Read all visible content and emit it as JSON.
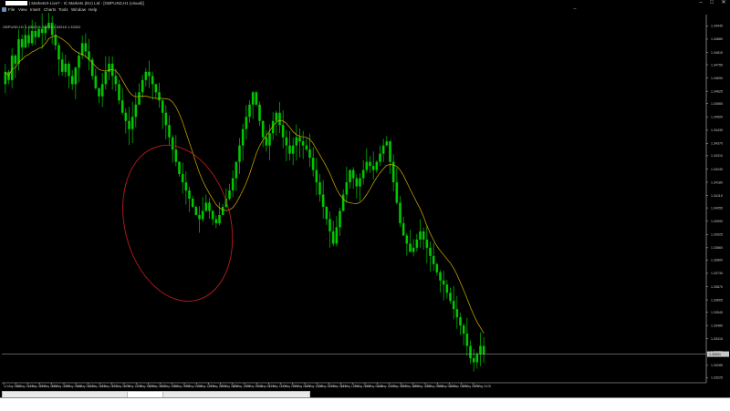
{
  "window": {
    "title": "| MarketsX-Live7 - IC Markets (EU) Ltd - [GBPUSD,H1 (visual)]",
    "controls": [
      "–",
      "□",
      "✕"
    ]
  },
  "menu": {
    "items": [
      "File",
      "View",
      "Insert",
      "Charts",
      "Tools",
      "Window",
      "Help"
    ]
  },
  "chart": {
    "info": "GBPUSD,H1  1.33322 1.33331 1.33318 1.33322",
    "current_price": "1.33341",
    "price_line_value": 1.3334,
    "colors": {
      "background": "#000000",
      "candles": "#00c800",
      "indicator": "#d4b000",
      "annotation": "#b91c1c",
      "axis": "#c8c8c8"
    },
    "annotation_shape": "ellipse"
  },
  "chart_data": {
    "type": "candlestick",
    "symbol": "GBPUSD",
    "timeframe": "H1",
    "ylim": [
      1.332,
      1.35
    ],
    "y_ticks": [
      "1.34945",
      "1.34880",
      "1.34815",
      "1.34755",
      "1.34690",
      "1.34625",
      "1.34565",
      "1.34500",
      "1.34435",
      "1.34370",
      "1.34310",
      "1.34245",
      "1.34180",
      "1.34115",
      "1.34055",
      "1.33990",
      "1.33925",
      "1.33860",
      "1.33800",
      "1.33735",
      "1.33670",
      "1.33605",
      "1.33545",
      "1.33480",
      "1.33415",
      "1.33350",
      "1.33285",
      "1.33225"
    ],
    "x_ticks": [
      "14 May 2025",
      "14 May 12:00",
      "14 May 20:00",
      "15 May 04:00",
      "15 May 12:00",
      "15 May 20:00",
      "16 May 04:00",
      "16 May 12:00",
      "16 May 20:00",
      "17 May 04:00",
      "17 May 12:00",
      "17 May 20:00",
      "18 May 04:00",
      "18 May 12:00",
      "18 May 20:00",
      "19 May 04:00",
      "19 May 12:00",
      "19 May 20:00",
      "20 May 04:00",
      "20 May 12:00",
      "20 May 20:00",
      "21 May 04:00",
      "21 May 12:00",
      "21 May 20:00",
      "22 May 04:00",
      "22 May 12:00",
      "22 May 20:00",
      "23 May 04:00",
      "23 May 12:00",
      "23 May 20:00",
      "24 May 04:00",
      "24 May 12:00",
      "24 May 20:00",
      "25 May 04:00",
      "25 May 12:00",
      "25 May 20:00",
      "26 May 04:00",
      "26 May 12:00",
      "26 May 20:00",
      "27 May 04:00",
      "27 May 12:00",
      "27 May 20:00",
      "28 May 04:00",
      "28 May 12:00",
      "28 May 20:00",
      "29 May 04:00",
      "29 May 12:00",
      "29 May 20:00",
      "30 May 04:00",
      "30 May 12:00",
      "30 May 20:00",
      "31 May 04:00",
      "31 May 12:00",
      "31 May 20:00",
      "1 Jun 04:00",
      "1 Jun 12:00",
      "1 Jun 20:00",
      "2 Jun 04:00",
      "2 Jun 12:00",
      "2 Jun 20:00",
      "3 Jun 04:00",
      "3 Jun 12:00",
      "3 Jun 20:00",
      "4 Jun 04:00",
      "4 Jun 12:00",
      "4 Jun 20:00",
      "5 Jun 04:00",
      "5 Jun 12:00",
      "5 Jun 20:00",
      "6 Jun 04:00",
      "6 Jun 12:00",
      "6 Jun 20:00",
      "7 Jun 04:00",
      "7 Jun 12:00",
      "7 Jun 20:00",
      "8 Jun 04:00",
      "8 Jun 12:00",
      "8 Jun 20:00",
      "9 Jun 04:00",
      "9 Jun 12:00",
      "9 Jun 20:00",
      "10 Jun 04:00",
      "10 Jun 12:00",
      "10 Jun 20:00",
      "11 Jun 04:00",
      "11 Jun 12:00",
      "11 Jun 20:00",
      "12 Jun 04:00",
      "12 Jun 12:00",
      "12 Jun 20:00",
      "13 Jun 04:00",
      "13 Jun 12:00",
      "13 Jun 20:00",
      "14 Jun 04:00",
      "14 Jun 12:00",
      "14 Jun 20:00",
      "15 Jun 04:00",
      "15 Jun 12:00",
      "15 Jun 20:00",
      "16 Jun 04:00",
      "16 Jun 12:00",
      "16 Jun 20:00",
      "17 Jun 04:00",
      "17 Jun 12:00",
      "17 Jun 20:00",
      "18 Jun 04:00",
      "18 Jun 12:00",
      "18 Jun 20:00",
      "19 Jun 04:00",
      "19 Jun 12:00",
      "19 Jun 20:00",
      "20 Jun 04:00",
      "20 Jun 12:00",
      "20 Jun 20:00",
      "21 Jun 04:00",
      "21 Jun 12:00",
      "21 Jun 20:00",
      "22 Jun 04:00",
      "22 Jun 12:00",
      "22 Jun 20:00",
      "23 Jun 04:00",
      "23 Jun 12:00",
      "23 Jun 20:00",
      "24 Jun 04:00",
      "24 Jun 12:00",
      "24 Jun 20:00",
      "25 Jun 04:00",
      "25 Jun 12:00",
      "25 Jun 20:00",
      "26 Jun 04:00",
      "26 Jun 12:00",
      "26 Jun 20:00",
      "27 Jun 04:00",
      "27 Jun 12:00",
      "27 Jun 20:00",
      "28 Jun 04:00",
      "28 Jun 12:00",
      "28 Jun 20:00",
      "29 Jun 04:00",
      "29 Jun 12:00",
      "29 Jun 20:00",
      "30 Jun 04:00",
      "30 Jun 12:00",
      "30 Jun 20:00",
      "1 Jul 04:00",
      "1 Jul 12:00",
      "1 Jul 20:00",
      "2 Jul 04:00",
      "2 Jul 12:00",
      "2 Jul 20:00",
      "3 Jul 04:00",
      "3 Jul 12:00",
      "3 Jul 20:00",
      "4 Jul 04:00",
      "4 Jul 12:00",
      "4 Jul 20:00",
      "5 Jul 04:00",
      "5 Jul 12:00",
      "5 Jul 20:00",
      "6 Jul 04:00",
      "6 Jul 12:00",
      "6 Jul 20:00",
      "7 Jul 04:00",
      "7 Jul 12:00",
      "7 Jul 20:00",
      "8 Jul 04:00",
      "8 Jul 12:00",
      "8 Jul 20:00",
      "9 Jul 04:00",
      "9 Jul 12:00",
      "9 Jul 20:00",
      "10 Jul 04:00",
      "10 Jul 12:00",
      "10 Jul 20:00",
      "11 Jul 04:00",
      "11 Jul 12:00",
      "11 Jul 20:00",
      "12 Jul 04:00",
      "12 Jul 12:00",
      "12 Jul 20:00",
      "13 Jul 04:00",
      "13 Jul 12:00",
      "13 Jul 20:00",
      "14 Jul 04:00",
      "14 Jul 12:00",
      "14 Jul 20:00",
      "15 Jul 04:00",
      "15 Jul 12:00",
      "15 Jul 20:00",
      "16 Jul 04:00",
      "16 Jul 12:00",
      "16 Jul 20:00",
      "17 Jul 04:00",
      "17 Jul 12:00",
      "17 Jul 20:00",
      "18 Jul 04:00",
      "18 Jul 12:00",
      "18 Jul 20:00",
      "19 Jul 04:00",
      "19 Jul 12:00",
      "19 Jul 20:00",
      "20 Jul 04:00",
      "20 Jul 12:00",
      "20 Jul 20:00",
      "21 Jul 04:00",
      "21 Jul 12:00",
      "21 Jul 20:00",
      "22 Jul 04:00",
      "22 Jul 12:00",
      "22 Jul 20:00",
      "23 Jul 04:00",
      "23 Jul 12:00",
      "23 Jul 20:00",
      "24 Jul 04:00",
      "24 Jul 12:00",
      "24 Jul 20:00",
      "25 Jul 04:00",
      "25 Jul 12:00",
      "25 Jul 20:00",
      "26 Jul 04:00",
      "26 Jul 12:00",
      "26 Jul 20:00",
      "27 Jul 04:00",
      "27 Jul 12:00",
      "27 Jul 20:00",
      "28 Jul 04:00",
      "28 Jul 12:00",
      "28 Jul 20:00",
      "29 Jul 04:00",
      "29 Jul 12:00",
      "29 Jul 20:00",
      "30 Jul 04:00",
      "30 Jul 12:00",
      "30 Jul 20:00",
      "31 Jul 04:00",
      "31 Jul 12:00",
      "31 Jul 20:00",
      "1 Aug 04:00",
      "1 Aug 12:00",
      "1 Aug 20:00",
      "2 Aug 04:00",
      "2 Aug 12:00",
      "2 Aug 20:00",
      "3 Aug 04:00",
      "3 Aug 12:00",
      "3 Aug 20:00",
      "4 Aug 04:00",
      "4 Aug 12:00",
      "4 Aug 20:00",
      "5 Aug 04:00",
      "5 Aug 12:00",
      "5 Aug 20:00",
      "6 Aug 04:00",
      "6 Aug 12:00",
      "6 Aug 20:00",
      "7 Aug 04:00",
      "7 Aug 12:00",
      "7 Aug 20:00",
      "8 Aug 04:00",
      "8 Aug 12:00",
      "8 Aug 20:00",
      "9 Aug 04:00",
      "9 Aug 12:00",
      "9 Aug 20:00",
      "10 Aug 04:00",
      "10 Aug 12:00",
      "10 Aug 20:00",
      "11 Aug 04:00",
      "11 Aug 12:00",
      "11 Aug 20:00",
      "12 Aug 04:00",
      "12 Aug 12:00",
      "12 Aug 20:00",
      "13 Aug 04:00",
      "13 Aug 12:00",
      "13 Aug 20:00",
      "14 Aug 04:00",
      "14 Aug 12:00",
      "14 Aug 20:00",
      "15 Aug 04:00",
      "15 Aug 12:00",
      "15 Aug 20:00",
      "16 Aug 04:00",
      "16 Aug 12:00",
      "16 Aug 20:00",
      "17 Aug 04:00",
      "17 Aug 12:00",
      "17 Aug 20:00",
      "18 Aug 04:00",
      "18 Aug 12:00",
      "18 Aug 20:00",
      "19 Aug 04:00",
      "19 Aug 12:00",
      "19 Aug 20:00",
      "20 Aug 04:00",
      "20 Aug 12:00",
      "20 Aug 20:00",
      "21 Aug 04:00",
      "21 Aug 12:00",
      "21 Aug 20:00",
      "22 Aug 04:00",
      "22 Aug 12:00",
      "22 Aug 20:00",
      "23 Aug 04:00",
      "23 Aug 12:00",
      "23 Aug 20:00",
      "24 Aug 04:00",
      "24 Aug 12:00",
      "24 Aug 20:00",
      "25 Aug 04:00",
      "25 Aug 12:00",
      "25 Aug 20:00",
      "26 Aug 04:00",
      "26 Aug 12:00",
      "26 Aug 20:00",
      "27 Aug 04:00",
      "27 Aug 12:00",
      "27 Aug 20:00",
      "28 Aug 04:00",
      "28 Aug 12:00",
      "28 Aug 20:00",
      "29 Aug 04:00",
      "29 Aug 12:00",
      "29 Aug 20:00",
      "30 Aug 04:00",
      "30 Aug 12:00",
      "30 Aug 20:00",
      "31 Aug 04:00",
      "31 Aug 12:00",
      "31 Aug 20:00"
    ],
    "x_ticks_shown": 40,
    "closes": [
      1.3472,
      1.3468,
      1.348,
      1.3476,
      1.3488,
      1.3484,
      1.349,
      1.3486,
      1.3492,
      1.3489,
      1.3493,
      1.3491,
      1.3494,
      1.3496,
      1.349,
      1.3485,
      1.3478,
      1.3472,
      1.3476,
      1.347,
      1.3466,
      1.3474,
      1.348,
      1.3486,
      1.3482,
      1.3478,
      1.347,
      1.3464,
      1.346,
      1.3466,
      1.3472,
      1.3476,
      1.347,
      1.3466,
      1.3458,
      1.3452,
      1.3448,
      1.3444,
      1.345,
      1.3456,
      1.3462,
      1.3468,
      1.3472,
      1.347,
      1.3466,
      1.3462,
      1.3458,
      1.3452,
      1.3446,
      1.344,
      1.3434,
      1.3428,
      1.3422,
      1.3418,
      1.3414,
      1.341,
      1.3406,
      1.3402,
      1.34,
      1.3404,
      1.3408,
      1.3404,
      1.34,
      1.3398,
      1.3402,
      1.3406,
      1.341,
      1.3414,
      1.342,
      1.3428,
      1.3436,
      1.3444,
      1.345,
      1.3456,
      1.3462,
      1.3456,
      1.3448,
      1.344,
      1.3436,
      1.3442,
      1.3448,
      1.3452,
      1.3446,
      1.344,
      1.3436,
      1.3432,
      1.3436,
      1.344,
      1.3438,
      1.3436,
      1.3434,
      1.343,
      1.3424,
      1.3418,
      1.3412,
      1.3406,
      1.34,
      1.3394,
      1.3388,
      1.3396,
      1.3404,
      1.3412,
      1.3418,
      1.3424,
      1.342,
      1.3416,
      1.342,
      1.3424,
      1.3428,
      1.3426,
      1.3424,
      1.3428,
      1.3432,
      1.3436,
      1.3438,
      1.3428,
      1.3418,
      1.3408,
      1.3398,
      1.3392,
      1.3388,
      1.3384,
      1.3386,
      1.339,
      1.3394,
      1.339,
      1.3386,
      1.3382,
      1.3378,
      1.3374,
      1.337,
      1.3368,
      1.3364,
      1.336,
      1.3356,
      1.3352,
      1.3348,
      1.3344,
      1.3338,
      1.3332,
      1.333,
      1.3334,
      1.3338,
      1.3334
    ],
    "indicator": "moving-average",
    "annotation": "ellipse"
  }
}
